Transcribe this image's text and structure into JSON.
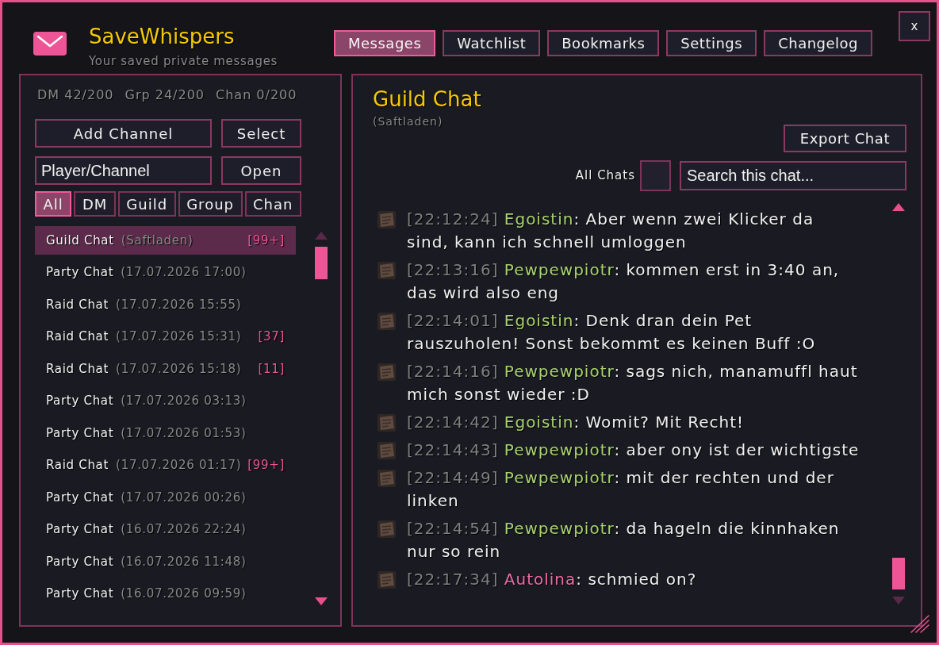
{
  "app": {
    "title": "SaveWhispers",
    "subtitle": "Your saved private messages"
  },
  "tabs": [
    {
      "label": "Messages",
      "selected": true
    },
    {
      "label": "Watchlist",
      "selected": false
    },
    {
      "label": "Bookmarks",
      "selected": false
    },
    {
      "label": "Settings",
      "selected": false
    },
    {
      "label": "Changelog",
      "selected": false
    }
  ],
  "close_button": {
    "label": "x"
  },
  "sidebar": {
    "stats": [
      "DM 42/200",
      "Grp 24/200",
      "Chan 0/200"
    ],
    "add_channel_button": "Add Channel",
    "select_button": "Select",
    "player_field": {
      "placeholder": "Player/Channel"
    },
    "open_button": "Open",
    "filters": [
      {
        "label": "All",
        "selected": true
      },
      {
        "label": "DM",
        "selected": false
      },
      {
        "label": "Guild",
        "selected": false
      },
      {
        "label": "Group",
        "selected": false
      },
      {
        "label": "Chan",
        "selected": false
      }
    ],
    "chats": [
      {
        "name": "Guild Chat",
        "detail": "(Saftladen)",
        "badge": "[99+]",
        "selected": true
      },
      {
        "name": "Party Chat",
        "detail": "(17.07.2026 17:00)",
        "selected": false
      },
      {
        "name": "Raid Chat",
        "detail": "(17.07.2026 15:55)",
        "selected": false
      },
      {
        "name": "Raid Chat",
        "detail": "(17.07.2026 15:31)",
        "badge": "[37]",
        "selected": false
      },
      {
        "name": "Raid Chat",
        "detail": "(17.07.2026 15:18)",
        "badge": "[11]",
        "selected": false
      },
      {
        "name": "Party Chat",
        "detail": "(17.07.2026 03:13)",
        "selected": false
      },
      {
        "name": "Party Chat",
        "detail": "(17.07.2026 01:53)",
        "selected": false
      },
      {
        "name": "Raid Chat",
        "detail": "(17.07.2026 01:17)",
        "badge": "[99+]",
        "selected": false
      },
      {
        "name": "Party Chat",
        "detail": "(17.07.2026 00:26)",
        "selected": false
      },
      {
        "name": "Party Chat",
        "detail": "(16.07.2026 22:24)",
        "selected": false
      },
      {
        "name": "Party Chat",
        "detail": "(16.07.2026 11:48)",
        "selected": false
      },
      {
        "name": "Party Chat",
        "detail": "(16.07.2026 09:59)",
        "selected": false
      }
    ]
  },
  "chat": {
    "title": "Guild Chat",
    "subtitle": "(Saftladen)",
    "export_button": "Export Chat",
    "all_chats": {
      "label": "All Chats",
      "checked": false
    },
    "search_field": {
      "placeholder": "Search this chat..."
    },
    "messages": [
      {
        "time": "[22:12:24]",
        "author": "Egoistin",
        "color": "#a8d36c",
        "text": ": Aber wenn zwei Klicker da sind, kann ich schnell umloggen"
      },
      {
        "time": "[22:13:16]",
        "author": "Pewpewpiotr",
        "color": "#a8d36c",
        "text": ": kommen erst in 3:40 an, das wird also eng"
      },
      {
        "time": "[22:14:01]",
        "author": "Egoistin",
        "color": "#a8d36c",
        "text": ": Denk dran dein Pet rauszuholen! Sonst bekommt es keinen Buff :O"
      },
      {
        "time": "[22:14:16]",
        "author": "Pewpewpiotr",
        "color": "#a8d36c",
        "text": ": sags nich, manamuffl haut mich sonst wieder :D"
      },
      {
        "time": "[22:14:42]",
        "author": "Egoistin",
        "color": "#a8d36c",
        "text": ": Womit? Mit Recht!"
      },
      {
        "time": "[22:14:43]",
        "author": "Pewpewpiotr",
        "color": "#a8d36c",
        "text": ": aber ony ist der wichtigste"
      },
      {
        "time": "[22:14:49]",
        "author": "Pewpewpiotr",
        "color": "#a8d36c",
        "text": ": mit der rechten und der linken"
      },
      {
        "time": "[22:14:54]",
        "author": "Pewpewpiotr",
        "color": "#a8d36c",
        "text": ": da hageln die kinnhaken nur so rein"
      },
      {
        "time": "[22:17:34]",
        "author": "Autolina",
        "color": "#f06aa6",
        "text": ": schmied on?"
      }
    ]
  }
}
